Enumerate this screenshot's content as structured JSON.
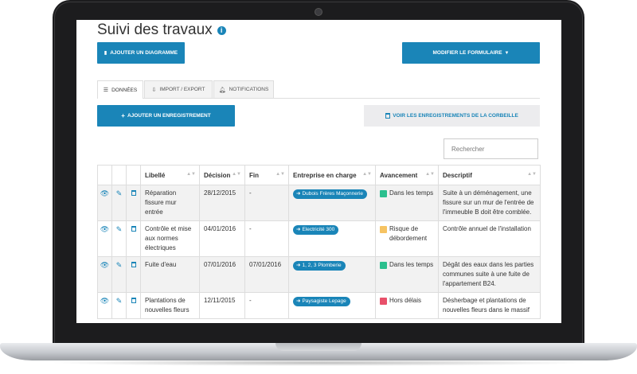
{
  "page": {
    "title": "Suivi des travaux",
    "add_chart_label": "AJOUTER UN DIAGRAMME",
    "modify_form_label": "MODIFIER LE FORMULAIRE"
  },
  "tabs": [
    {
      "label": "DONNÉES",
      "icon": "list-icon",
      "active": true
    },
    {
      "label": "IMPORT / EXPORT",
      "icon": "import-export-icon",
      "active": false
    },
    {
      "label": "NOTIFICATIONS",
      "icon": "bell-icon",
      "active": false
    }
  ],
  "actions": {
    "add_record_label": "AJOUTER UN ENREGISTREMENT",
    "trash_label": "VOIR LES ENREGISTREMENTS DE LA CORBEILLE"
  },
  "search": {
    "placeholder": "Rechercher"
  },
  "table": {
    "columns": [
      "Libellé",
      "Décision",
      "Fin",
      "Entreprise en charge",
      "Avancement",
      "Descriptif"
    ],
    "rows": [
      {
        "libelle": "Réparation fissure mur entrée",
        "decision": "28/12/2015",
        "fin": "-",
        "entreprise": "Dubois Frères Maçonnerie",
        "avancement": "Dans les temps",
        "status_color": "#2bbf8e",
        "descriptif": "Suite à un déménagement, une fissure sur un mur de l'entrée de l'immeuble B doit être comblée."
      },
      {
        "libelle": "Contrôle et mise aux normes électriques",
        "decision": "04/01/2016",
        "fin": "-",
        "entreprise": "Electricité 300",
        "avancement": "Risque de débordement",
        "status_color": "#f6c362",
        "descriptif": "Contrôle annuel de l'installation"
      },
      {
        "libelle": "Fuite d'eau",
        "decision": "07/01/2016",
        "fin": "07/01/2016",
        "entreprise": "1, 2, 3 Plomberie",
        "avancement": "Dans les temps",
        "status_color": "#2bbf8e",
        "descriptif": "Dégât des eaux dans les parties communes suite à une fuite de l'appartement B24."
      },
      {
        "libelle": "Plantations de nouvelles fleurs",
        "decision": "12/11/2015",
        "fin": "-",
        "entreprise": "Paysagiste Lepage",
        "avancement": "Hors délais",
        "status_color": "#e8506a",
        "descriptif": "Désherbage et plantations de nouvelles fleurs dans le massif"
      }
    ]
  },
  "colors": {
    "accent": "#1a85b8",
    "frame": "#1c1c1e"
  }
}
